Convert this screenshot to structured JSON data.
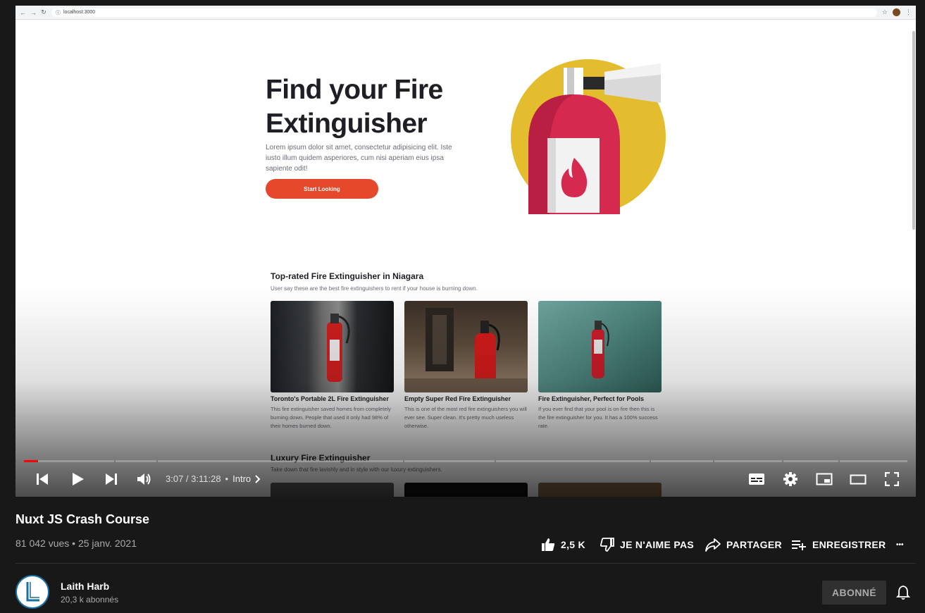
{
  "browser": {
    "url": "localhost:3000"
  },
  "hero": {
    "title": "Find your Fire Extinguisher",
    "description": "Lorem ipsum dolor sit amet, consectetur adipisicing elit. Iste iusto illum quidem asperiores, cum nisi aperiam eius ipsa sapiente odit!",
    "button": "Start Looking"
  },
  "top_rated": {
    "title": "Top-rated Fire Extinguisher in Niagara",
    "subtitle": "User say these are the best fire extinguishers to rent if your house is burning down.",
    "cards": [
      {
        "title": "Toronto's Portable 2L Fire Extinguisher",
        "description": "This fire extinguisher saved homes from completely burning down. People that used it only had 98% of their homes burned down."
      },
      {
        "title": "Empty Super Red Fire Extinguisher",
        "description": "This is one of the most red fire extinguishers you will ever see. Super clean. It's pretty much useless otherwise."
      },
      {
        "title": "Fire Extinguisher, Perfect for Pools",
        "description": "If you ever find that your pool is on fire then this is the fire extinguisher for you. It has a 100% success rate."
      }
    ]
  },
  "luxury": {
    "title": "Luxury Fire Extinguisher",
    "subtitle": "Take down that fire lavishly and in style with our luxury extinguishers."
  },
  "player": {
    "current_time": "3:07",
    "duration": "3:11:28",
    "time_display": "3:07 / 3:11:28",
    "separator": "•",
    "chapter": "Intro",
    "progress_fraction": 0.0163,
    "colors": {
      "played": "#ff0000",
      "accent": "#e5482a"
    },
    "icons": [
      "previous-icon",
      "play-icon",
      "next-icon",
      "volume-icon",
      "subtitles-icon",
      "settings-icon",
      "miniplayer-icon",
      "theater-icon",
      "fullscreen-icon"
    ]
  },
  "video": {
    "title": "Nuxt JS Crash Course",
    "meta": "81 042 vues • 25 janv. 2021",
    "actions": {
      "like_count": "2,5 K",
      "dislike": "JE N'AIME PAS",
      "share": "PARTAGER",
      "save": "ENREGISTRER",
      "more": "•••"
    }
  },
  "channel": {
    "name": "Laith Harb",
    "subscribers": "20,3 k abonnés",
    "subscribe_button": "ABONNÉ",
    "avatar_letter": "L"
  }
}
